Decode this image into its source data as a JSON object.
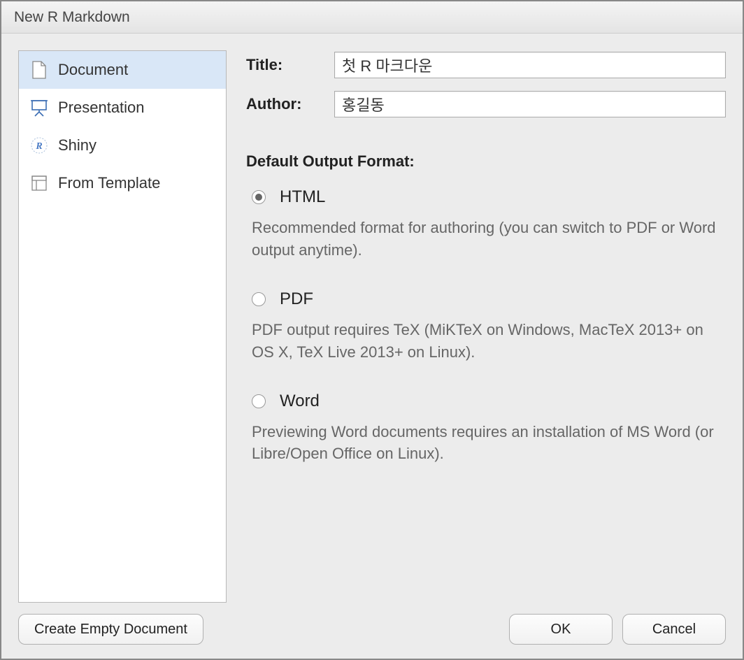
{
  "dialog": {
    "title": "New R Markdown"
  },
  "sidebar": {
    "items": [
      {
        "label": "Document",
        "icon": "document-icon",
        "selected": true
      },
      {
        "label": "Presentation",
        "icon": "presentation-icon",
        "selected": false
      },
      {
        "label": "Shiny",
        "icon": "shiny-icon",
        "selected": false
      },
      {
        "label": "From Template",
        "icon": "template-icon",
        "selected": false
      }
    ]
  },
  "fields": {
    "title_label": "Title:",
    "title_value": "첫 R 마크다운",
    "author_label": "Author:",
    "author_value": "홍길동"
  },
  "format": {
    "heading": "Default Output Format:",
    "options": [
      {
        "label": "HTML",
        "checked": true,
        "desc": "Recommended format for authoring (you can switch to PDF or Word output anytime)."
      },
      {
        "label": "PDF",
        "checked": false,
        "desc": "PDF output requires TeX (MiKTeX on Windows, MacTeX 2013+ on OS X, TeX Live 2013+ on Linux)."
      },
      {
        "label": "Word",
        "checked": false,
        "desc": "Previewing Word documents requires an installation of MS Word (or Libre/Open Office on Linux)."
      }
    ]
  },
  "buttons": {
    "create_empty": "Create Empty Document",
    "ok": "OK",
    "cancel": "Cancel"
  }
}
